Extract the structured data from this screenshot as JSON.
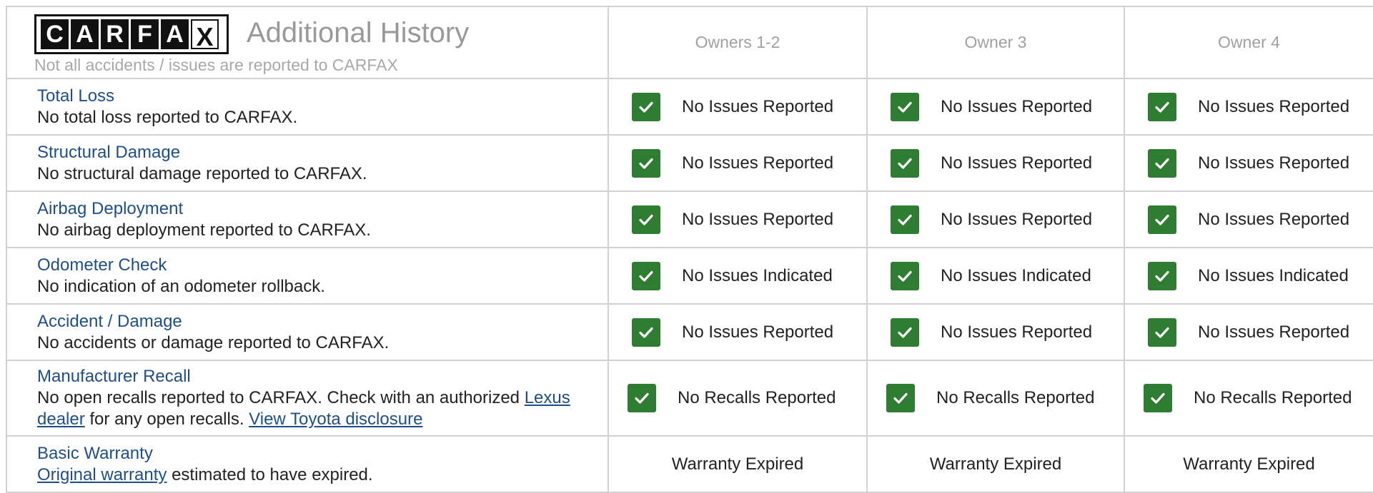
{
  "header": {
    "logo_letters": [
      "C",
      "A",
      "R",
      "F",
      "A",
      "X"
    ],
    "title": "Additional History",
    "note": "Not all accidents / issues are reported to CARFAX",
    "owners": [
      "Owners 1-2",
      "Owner 3",
      "Owner 4"
    ]
  },
  "colors": {
    "label_blue": "#1f4e8a",
    "check_green": "#2e7d32",
    "grid_gray": "#d2d2d2",
    "muted_text": "#999999"
  },
  "icons": {
    "status": "checkmark-icon"
  },
  "rows": [
    {
      "label": "Total Loss",
      "desc": "No total loss reported to CARFAX.",
      "status": [
        "No Issues Reported",
        "No Issues Reported",
        "No Issues Reported"
      ]
    },
    {
      "label": "Structural Damage",
      "desc": "No structural damage reported to CARFAX.",
      "status": [
        "No Issues Reported",
        "No Issues Reported",
        "No Issues Reported"
      ]
    },
    {
      "label": "Airbag Deployment",
      "desc": "No airbag deployment reported to CARFAX.",
      "status": [
        "No Issues Reported",
        "No Issues Reported",
        "No Issues Reported"
      ]
    },
    {
      "label": "Odometer Check",
      "desc": "No indication of an odometer rollback.",
      "status": [
        "No Issues Indicated",
        "No Issues Indicated",
        "No Issues Indicated"
      ]
    },
    {
      "label": "Accident / Damage",
      "desc": "No accidents or damage reported to CARFAX.",
      "status": [
        "No Issues Reported",
        "No Issues Reported",
        "No Issues Reported"
      ]
    },
    {
      "label": "Manufacturer Recall",
      "desc_pre": "No open recalls reported to CARFAX. Check with an authorized ",
      "desc_link1": "Lexus dealer",
      "desc_mid": " for any open recalls. ",
      "desc_link2": "View Toyota disclosure",
      "status": [
        "No Recalls Reported",
        "No Recalls Reported",
        "No Recalls Reported"
      ]
    },
    {
      "label": "Basic Warranty",
      "desc_link": "Original warranty",
      "desc_post": " estimated to have expired.",
      "status": [
        "Warranty Expired",
        "Warranty Expired",
        "Warranty Expired"
      ]
    }
  ]
}
